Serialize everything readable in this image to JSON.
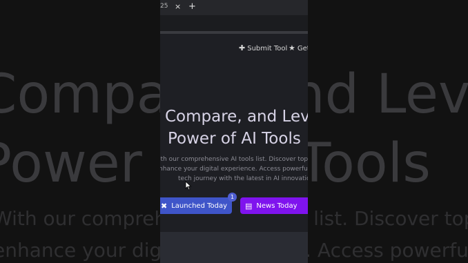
{
  "background": {
    "big_line_1": "Compare, and Leve",
    "big_line_2": "Power of AI Tools",
    "small_line_1": "With our comprehensive AI tools list. Discover top-notch",
    "small_line_2": "enhance your digital experience. Access powerful AI on"
  },
  "browser": {
    "tab_fragment": "25",
    "close_icon": "×",
    "new_tab_icon": "+"
  },
  "nav": {
    "submit_label": "Submit Tool",
    "get_label": "Get"
  },
  "hero": {
    "title_line_1": "Compare, and Leve",
    "title_line_2": "Power of AI Tools",
    "desc_line_1": "ith our comprehensive AI tools list. Discover top-notch",
    "desc_line_2": "nhance your digital experience. Access powerful AI on",
    "desc_line_3": "tech journey with the latest in AI innovations."
  },
  "buttons": {
    "launched_label": "Launched Today",
    "launched_badge": "1",
    "news_label": "News Today"
  },
  "colors": {
    "launched_bg": "#3f55c9",
    "news_bg": "#7f13ee",
    "page_bg": "#1e1f24"
  },
  "icons": {
    "submit": "plus-icon",
    "get": "star-icon",
    "launched": "rocket-icon",
    "news": "newspaper-icon"
  }
}
